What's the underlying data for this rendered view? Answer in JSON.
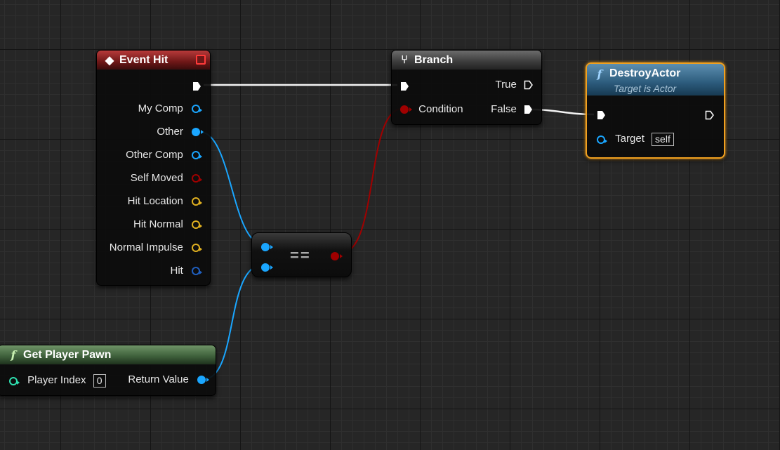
{
  "event_hit": {
    "title": "Event Hit",
    "pins": [
      "My Comp",
      "Other",
      "Other Comp",
      "Self Moved",
      "Hit Location",
      "Hit Normal",
      "Normal Impulse",
      "Hit"
    ]
  },
  "branch": {
    "title": "Branch",
    "true_label": "True",
    "condition_label": "Condition",
    "false_label": "False"
  },
  "destroy_actor": {
    "title": "DestroyActor",
    "subtitle": "Target is Actor",
    "target_label": "Target",
    "target_value": "self"
  },
  "equals": {
    "symbol": "=="
  },
  "get_player_pawn": {
    "title": "Get Player Pawn",
    "player_index_label": "Player Index",
    "player_index_value": "0",
    "return_label": "Return Value"
  },
  "colors": {
    "object_pin": "#1aa6ff",
    "bool_pin": "#a00000",
    "vector_pin": "#e0b020",
    "struct_pin": "#1f5fbf",
    "exec": "#ffffff",
    "selection": "#f0a020"
  }
}
